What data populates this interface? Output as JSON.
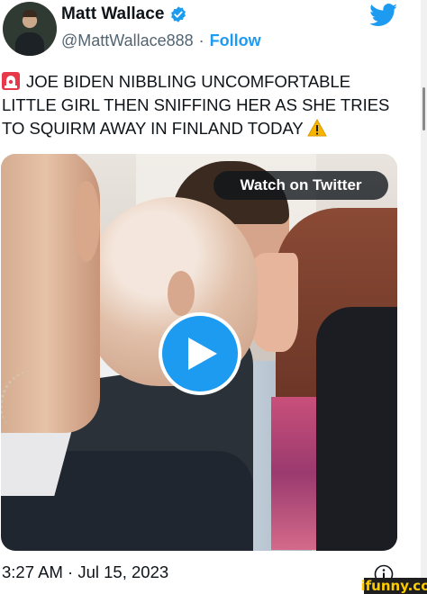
{
  "author": {
    "name": "Matt Wallace",
    "handle": "@MattWallace888",
    "separator": "·",
    "follow_label": "Follow",
    "verified": true
  },
  "icons": {
    "platform": "twitter-bird-icon",
    "verified": "verified-badge-icon",
    "siren": "police-siren-emoji",
    "warning": "warning-emoji",
    "play": "play-icon",
    "info": "info-icon"
  },
  "tweet": {
    "lines": [
      "JOE BIDEN NIBBLING UNCOMFORTABLE",
      "LITTLE GIRL THEN SNIFFING HER AS SHE TRIES",
      "TO SQUIRM AWAY IN FINLAND TODAY"
    ]
  },
  "video": {
    "watch_label": "Watch on Twitter"
  },
  "timestamp": {
    "time": "3:27 AM",
    "separator": "·",
    "date": "Jul 15, 2023"
  },
  "watermark": "ifunny.co",
  "colors": {
    "accent": "#1d9bf0",
    "text": "#0f1419",
    "muted": "#536471"
  }
}
